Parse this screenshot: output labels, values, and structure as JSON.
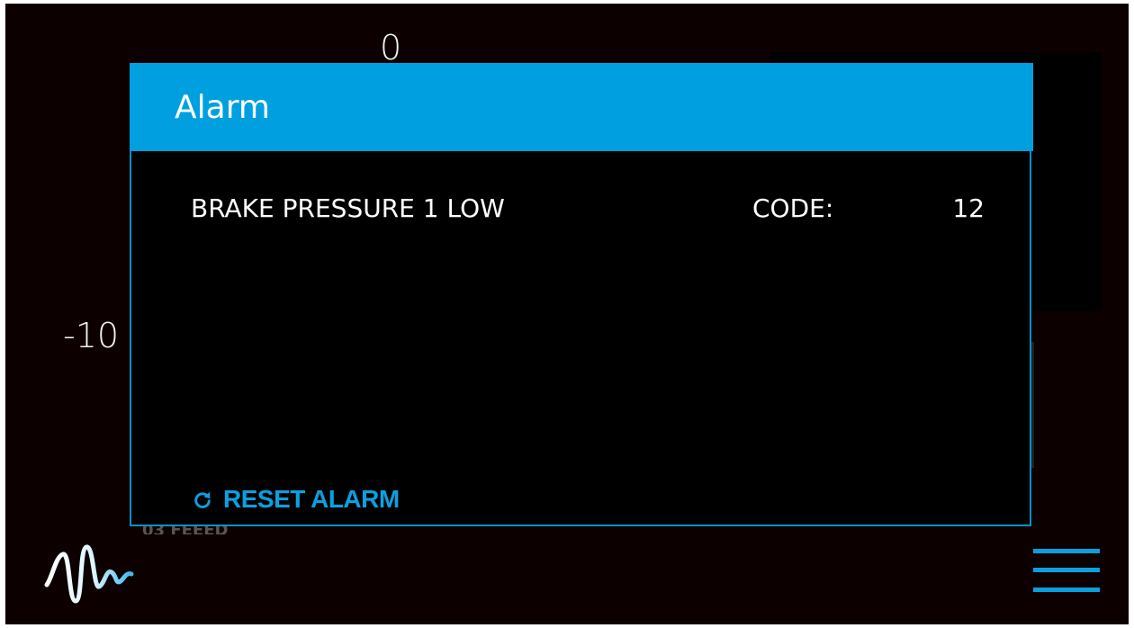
{
  "background": {
    "top_value": "0",
    "left_value": "-10",
    "obscured_text": "03 FEEED"
  },
  "dialog": {
    "title": "Alarm",
    "alarm": {
      "message": "BRAKE PRESSURE 1 LOW",
      "code_label": "CODE:",
      "code_value": "12"
    },
    "reset_label": "RESET ALARM",
    "reset_icon": "refresh-icon"
  },
  "icons": {
    "logo": "waveform-logo-icon",
    "menu": "hamburger-menu-icon"
  },
  "colors": {
    "accent": "#00a0e0",
    "screen_background": "#0c0000",
    "dialog_background": "#000000",
    "text": "#ffffff"
  }
}
